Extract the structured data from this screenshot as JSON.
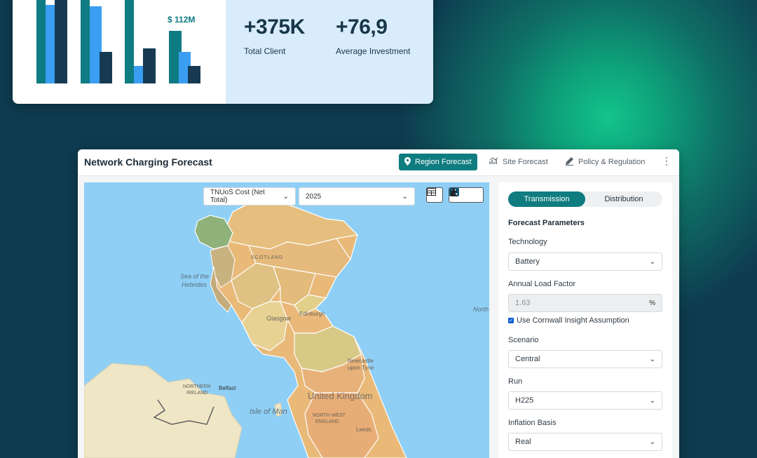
{
  "stats_card": {
    "bar_label": "$ 112M",
    "stats": [
      {
        "value": "+375K",
        "label": "Total Client"
      },
      {
        "value": "+76,9",
        "label": "Average Investment"
      }
    ],
    "colors": {
      "teal": "#0e7c82",
      "blue": "#3a9ef2",
      "navy": "#173a52"
    }
  },
  "window": {
    "title": "Network Charging Forecast",
    "nav": [
      {
        "label": "Region Forecast",
        "icon": "map-pin-icon",
        "active": true
      },
      {
        "label": "Site Forecast",
        "icon": "chart-icon",
        "active": false
      },
      {
        "label": "Policy & Regulation",
        "icon": "pencil-icon",
        "active": false
      }
    ],
    "more_icon": "kebab-icon"
  },
  "map": {
    "metric_select": "TNUoS Cost (Net Total)",
    "year_select": "2025",
    "labels": {
      "sea_hebrides_1": "Sea of the",
      "sea_hebrides_2": "Hebrides",
      "scotland": "SCOTLAND",
      "north": "North",
      "glasgow": "Glasgow",
      "edinburgh": "Edinburgh",
      "newcastle_1": "Newcastle",
      "newcastle_2": "upon Tyne",
      "ni_1": "NORTHERN",
      "ni_2": "IRELAND",
      "belfast": "Belfast",
      "isle_of_man": "Isle of Man",
      "uk": "United Kingdom",
      "nw_1": "NORTH WEST",
      "nw_2": "ENGLAND",
      "leeds": "Leeds"
    }
  },
  "panel": {
    "tabs": [
      "Transmission",
      "Distribution"
    ],
    "active_tab": "Transmission",
    "section_title": "Forecast Parameters",
    "technology_label": "Technology",
    "technology_value": "Battery",
    "load_factor_label": "Annual Load Factor",
    "load_factor_value": "1.63",
    "load_factor_unit": "%",
    "checkbox_label": "Use Cornwall Insight Assumption",
    "checkbox_checked": true,
    "scenario_label": "Scenario",
    "scenario_value": "Central",
    "run_label": "Run",
    "run_value": "H225",
    "inflation_label": "Inflation Basis",
    "inflation_value": "Real"
  }
}
